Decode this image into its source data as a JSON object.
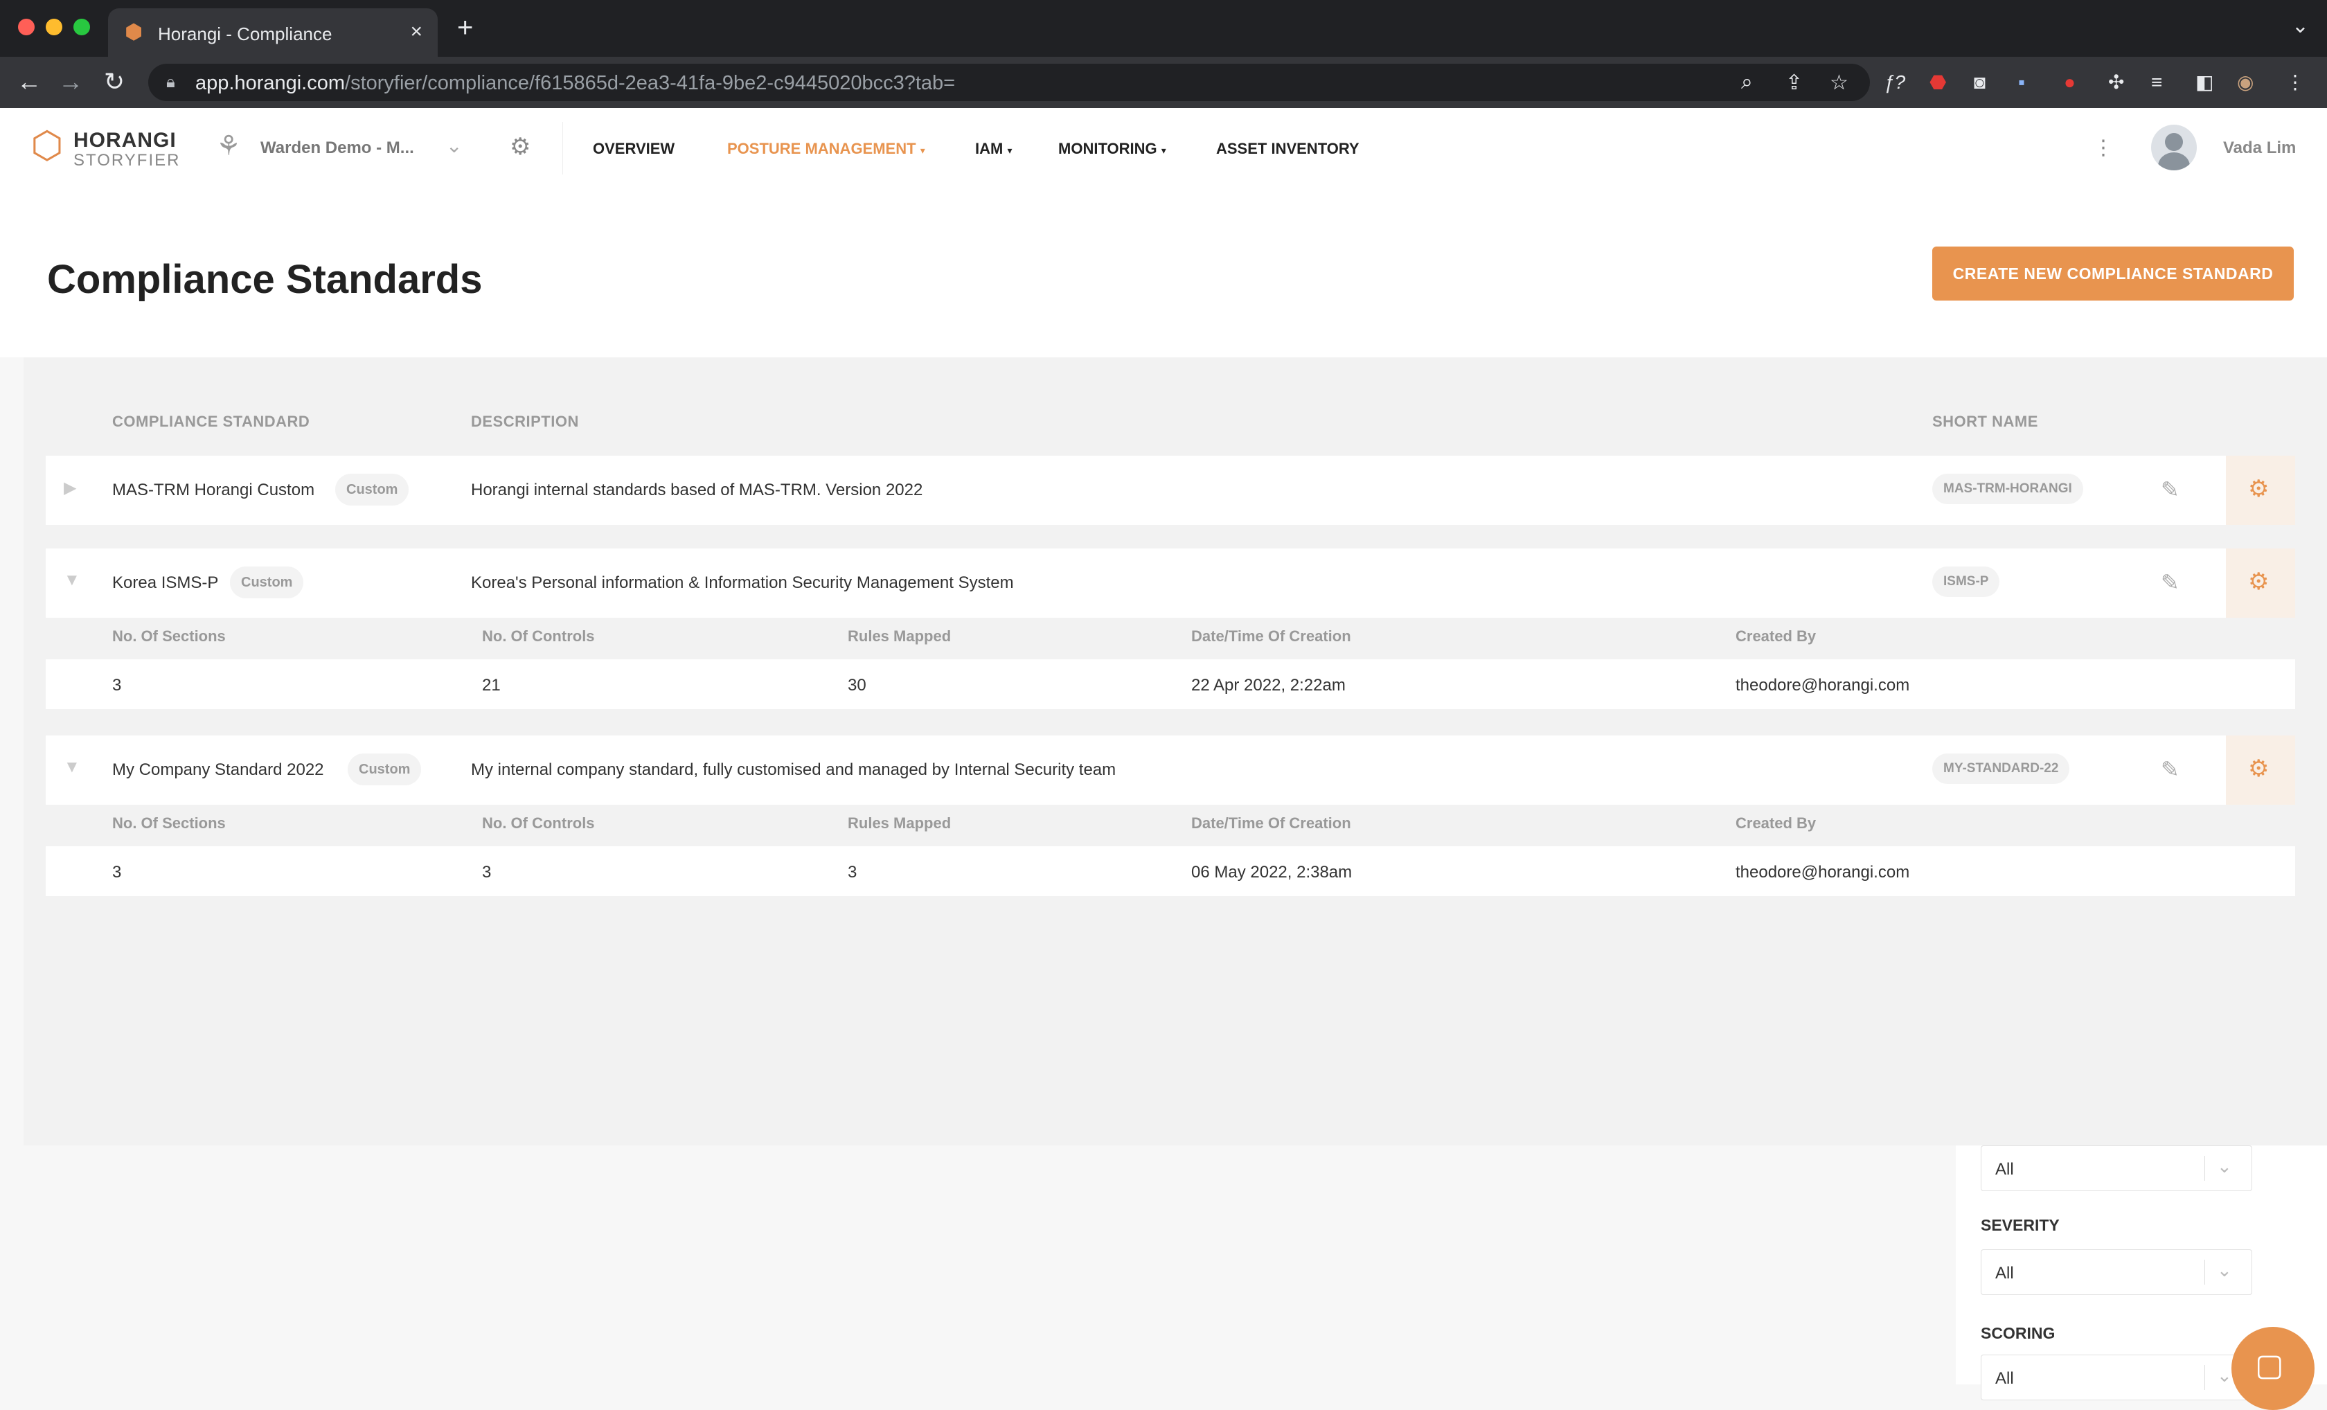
{
  "browser": {
    "tab_title": "Horangi - Compliance",
    "close_glyph": "×",
    "new_tab_glyph": "+",
    "url_host": "app.horangi.com",
    "url_path": "/storyfier/compliance/f615865d-2ea3-41fa-9be2-c9445020bcc3?tab="
  },
  "header": {
    "logo_top": "HORANGI",
    "logo_bottom": "STORYFIER",
    "workspace": "Warden Demo - M...",
    "menu": {
      "overview": "OVERVIEW",
      "posture": "POSTURE MANAGEMENT",
      "iam": "IAM",
      "monitoring": "MONITORING",
      "asset": "ASSET INVENTORY"
    },
    "user_name": "Vada Lim"
  },
  "page": {
    "title": "Compliance Standards",
    "create_button": "CREATE NEW COMPLIANCE STANDARD"
  },
  "table": {
    "columns": {
      "standard": "COMPLIANCE STANDARD",
      "description": "DESCRIPTION",
      "short_name": "SHORT NAME"
    },
    "detail_headers": {
      "sections": "No. Of Sections",
      "controls": "No. Of Controls",
      "rules": "Rules Mapped",
      "created_at": "Date/Time Of Creation",
      "created_by": "Created By"
    },
    "rows": [
      {
        "name": "MAS-TRM Horangi Custom",
        "badge": "Custom",
        "description": "Horangi internal standards based of MAS-TRM. Version 2022",
        "short_name": "MAS-TRM-HORANGI"
      },
      {
        "name": "Korea ISMS-P",
        "badge": "Custom",
        "description": "Korea's Personal information & Information Security Management System",
        "short_name": "ISMS-P",
        "details": {
          "sections": "3",
          "controls": "21",
          "rules": "30",
          "created_at": "22 Apr 2022, 2:22am",
          "created_by": "theodore@horangi.com"
        }
      },
      {
        "name": "My Company Standard 2022",
        "badge": "Custom",
        "description": "My internal company standard, fully customised and managed by Internal Security team",
        "short_name": "MY-STANDARD-22",
        "details": {
          "sections": "3",
          "controls": "3",
          "rules": "3",
          "created_at": "06 May 2022, 2:38am",
          "created_by": "theodore@horangi.com"
        }
      }
    ]
  },
  "filters": {
    "first_value": "All",
    "severity_label": "SEVERITY",
    "severity_value": "All",
    "scoring_label": "SCORING",
    "scoring_value": "All"
  },
  "colors": {
    "accent": "#e8944f",
    "browser_bg": "#202124",
    "toolbar_bg": "#35363a"
  }
}
